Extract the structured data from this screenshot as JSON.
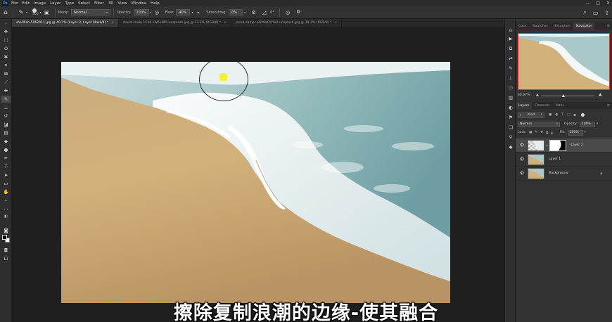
{
  "app": {
    "name": "Ps"
  },
  "menu": [
    "File",
    "Edit",
    "Image",
    "Layer",
    "Type",
    "Select",
    "Filter",
    "3D",
    "View",
    "Window",
    "Help"
  ],
  "window_controls": [
    "—",
    "□",
    "✕"
  ],
  "options_bar": {
    "brush_size": "300",
    "mode_label": "Mode:",
    "mode_value": "Normal",
    "opacity_label": "Opacity:",
    "opacity_value": "100%",
    "flow_label": "Flow:",
    "flow_value": "40%",
    "smoothing_label": "Smoothing:",
    "smoothing_value": "0%",
    "angle_value": "0°"
  },
  "tabs": [
    {
      "label": "shellfish-5062011.jpg @ 40.7% (Layer 2, Layer Mask/8) *",
      "close": "×",
      "active": true
    },
    {
      "label": "david-clode-1Chb-sW6oWM-unsplash.jpg @ 33.3% (RGB/8) *",
      "close": "×",
      "active": false
    },
    {
      "label": "jacob-sumpr-eGP8qFYYbi0-unsplash.jpg @ 39.3% (RGB/8) *",
      "close": "×",
      "active": false
    }
  ],
  "right_panel": {
    "top_tabs": [
      "Color",
      "Swatches",
      "Histogram",
      "Navigator"
    ],
    "top_active": "Navigator",
    "zoom": "40.67%",
    "layer_tabs": [
      "Layers",
      "Channels",
      "Paths"
    ],
    "layer_active": "Layers",
    "kind_label": "Kind",
    "blend_mode": "Normal",
    "opacity_label": "Opacity:",
    "opacity_value": "100%",
    "lock_label": "Lock:",
    "fill_label": "Fill:",
    "fill_value": "100%",
    "layers": [
      {
        "name": "Layer 2",
        "active": true
      },
      {
        "name": "Layer 1",
        "active": false
      },
      {
        "name": "Background",
        "active": false,
        "locked": true
      }
    ]
  },
  "subtitle": "擦除复制浪潮的边缘-使其融合",
  "colors": {
    "accent": "#31a8ff",
    "navigator_frame": "#e03030",
    "highlight": "#f2ef1e"
  }
}
